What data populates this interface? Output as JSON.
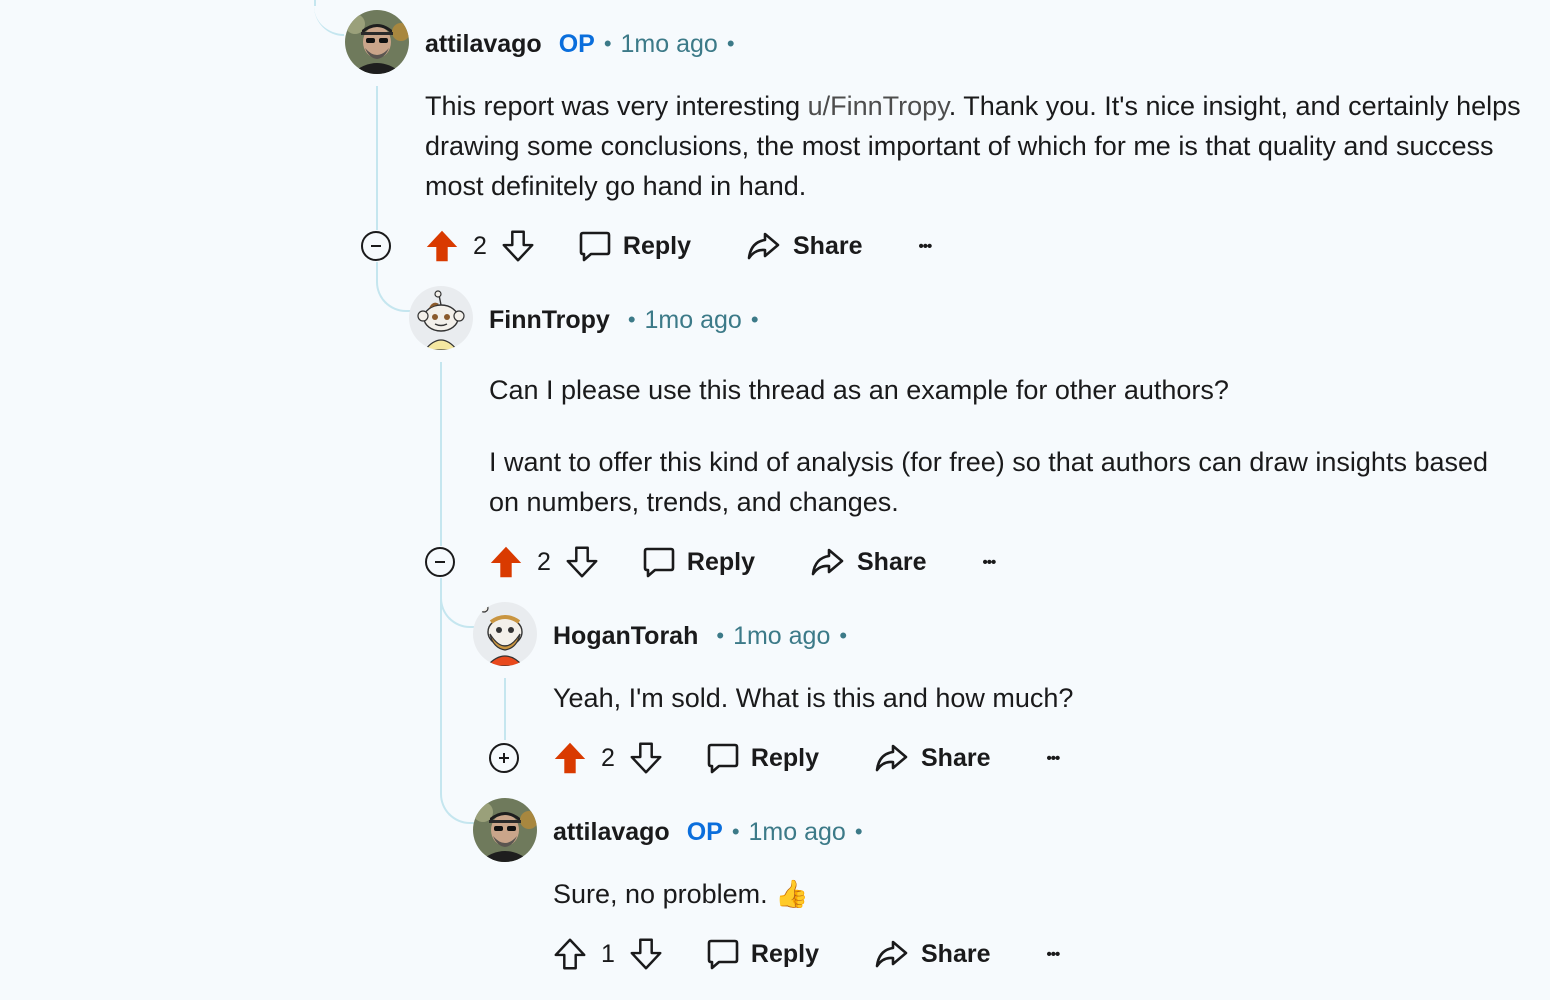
{
  "colors": {
    "background": "#f6fafd",
    "thread_line": "#c5e6ef",
    "upvote_active": "#d93a00",
    "op_badge": "#0a6edc",
    "timestamp": "#3c7a88"
  },
  "comments": [
    {
      "author": "attilavago",
      "op_badge": "OP",
      "separator": "•",
      "time": "1mo ago",
      "body_pre": "This report was very interesting ",
      "mention": "u/FinnTropy",
      "body_post": ". Thank you. It's nice insight, and certainly helps drawing some conclusions, the most important of which for me is that quality and success most definitely go hand in hand.",
      "score": "2",
      "reply_label": "Reply",
      "share_label": "Share",
      "more_label": "•••",
      "upvoted": true
    },
    {
      "author": "FinnTropy",
      "separator": "•",
      "time": "1mo ago",
      "paragraph_1": "Can I please use this thread as an example for other authors?",
      "paragraph_2": "I want to offer this kind of analysis (for free) so that authors can draw insights based on numbers, trends, and changes.",
      "score": "2",
      "reply_label": "Reply",
      "share_label": "Share",
      "more_label": "•••",
      "upvoted": true
    },
    {
      "author": "HoganTorah",
      "separator": "•",
      "time": "1mo ago",
      "body": "Yeah, I'm sold. What is this and how much?",
      "score": "2",
      "reply_label": "Reply",
      "share_label": "Share",
      "more_label": "•••",
      "upvoted": true
    },
    {
      "author": "attilavago",
      "op_badge": "OP",
      "separator": "•",
      "time": "1mo ago",
      "body": "Sure, no problem.",
      "emoji": "👍",
      "score": "1",
      "reply_label": "Reply",
      "share_label": "Share",
      "more_label": "•••",
      "upvoted": false
    }
  ]
}
